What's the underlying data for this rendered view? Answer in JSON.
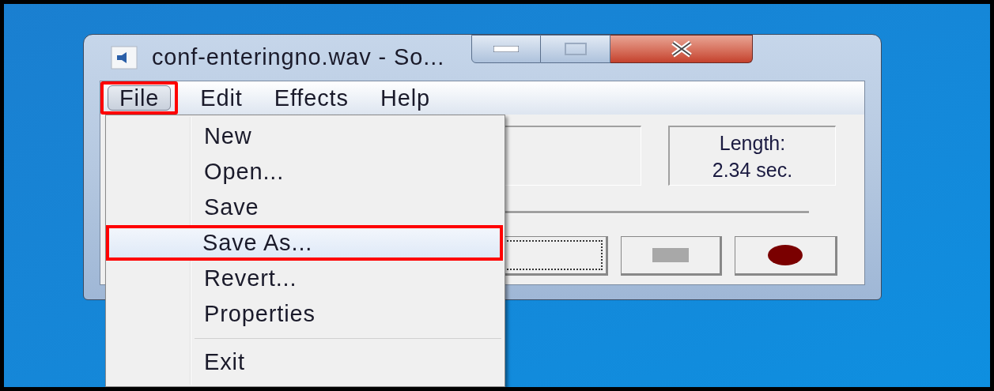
{
  "window": {
    "title": "conf-enteringno.wav - So..."
  },
  "menu_bar": [
    {
      "label": "File",
      "selected": true
    },
    {
      "label": "Edit",
      "selected": false
    },
    {
      "label": "Effects",
      "selected": false
    },
    {
      "label": "Help",
      "selected": false
    }
  ],
  "file_menu": {
    "items": [
      {
        "kind": "item",
        "label": "New",
        "selected": false
      },
      {
        "kind": "item",
        "label": "Open...",
        "selected": false
      },
      {
        "kind": "item",
        "label": "Save",
        "selected": false
      },
      {
        "kind": "item",
        "label": "Save As...",
        "selected": true
      },
      {
        "kind": "item",
        "label": "Revert...",
        "selected": false
      },
      {
        "kind": "item",
        "label": "Properties",
        "selected": false
      },
      {
        "kind": "separator"
      },
      {
        "kind": "item",
        "label": "Exit",
        "selected": false
      }
    ]
  },
  "length": {
    "label": "Length:",
    "value": "2.34 sec."
  }
}
